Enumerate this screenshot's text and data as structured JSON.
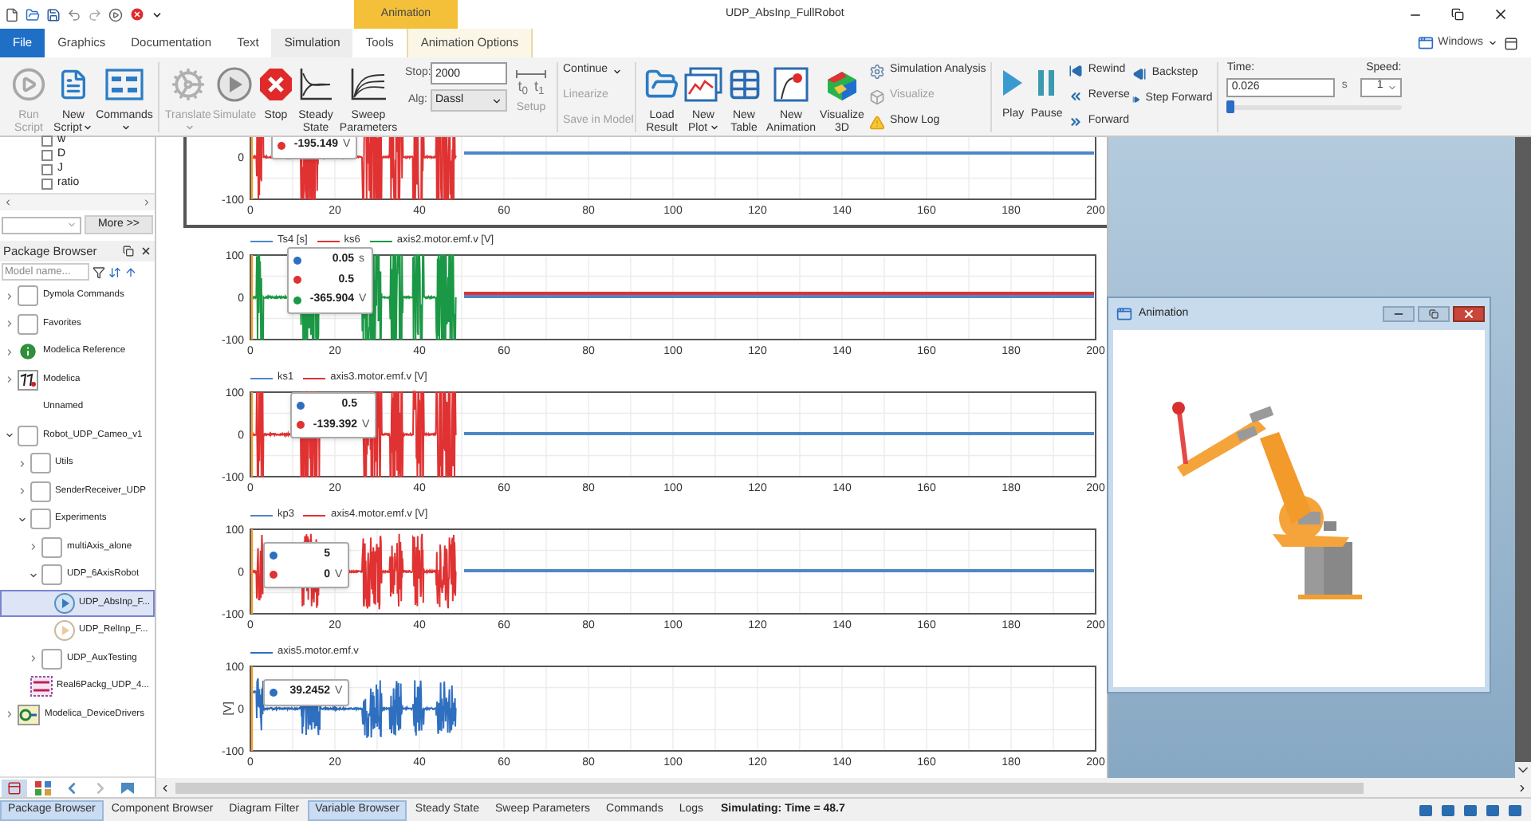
{
  "title_bar": {
    "title": "UDP_AbsInp_FullRobot",
    "context_header": "Animation"
  },
  "menu_tabs": [
    {
      "label": "File",
      "kind": "file",
      "selected": false
    },
    {
      "label": "Graphics",
      "kind": "normal",
      "selected": false
    },
    {
      "label": "Documentation",
      "kind": "normal",
      "selected": false
    },
    {
      "label": "Text",
      "kind": "normal",
      "selected": false
    },
    {
      "label": "Simulation",
      "kind": "normal",
      "selected": true
    },
    {
      "label": "Tools",
      "kind": "normal",
      "selected": false
    },
    {
      "label": "Animation Options",
      "kind": "context",
      "selected": false
    }
  ],
  "windows_menu": {
    "label": "Windows"
  },
  "ribbon": {
    "script": [
      {
        "label": "Run Script",
        "dropdown": false,
        "disabled": true
      },
      {
        "label": "New Script",
        "dropdown": true,
        "disabled": false
      },
      {
        "label": "Commands",
        "dropdown": true,
        "disabled": false
      }
    ],
    "simulate": [
      {
        "label": "Translate",
        "dropdown": true,
        "disabled": true
      },
      {
        "label": "Simulate",
        "dropdown": false,
        "disabled": true
      },
      {
        "label": "Stop",
        "dropdown": false,
        "disabled": false
      },
      {
        "label": "Steady State",
        "dropdown": false,
        "disabled": false
      },
      {
        "label": "Sweep Parameters",
        "dropdown": false,
        "disabled": false
      }
    ],
    "stop_time": {
      "label": "Stop:",
      "value": "2000"
    },
    "algorithm": {
      "label": "Alg:",
      "value": "Dassl"
    },
    "setup": {
      "label": "Setup",
      "icon_labels": [
        "t$_{0}$",
        "t$_{1}$"
      ]
    },
    "continue": [
      {
        "label": "Continue",
        "dropdown": true,
        "disabled": false
      },
      {
        "label": "Linearize",
        "dropdown": false,
        "disabled": true
      },
      {
        "label": "Save in Model",
        "dropdown": false,
        "disabled": true
      }
    ],
    "results": [
      {
        "label": "Load Result",
        "dropdown": false
      },
      {
        "label": "New Plot",
        "dropdown": true
      },
      {
        "label": "New Table",
        "dropdown": false
      },
      {
        "label": "New Animation",
        "dropdown": false
      },
      {
        "label": "Visualize 3D",
        "dropdown": false
      }
    ],
    "analysis": [
      {
        "label": "Simulation Analysis",
        "disabled": false
      },
      {
        "label": "Visualize",
        "disabled": true
      },
      {
        "label": "Show Log",
        "disabled": false
      }
    ],
    "playback": [
      {
        "label": "Play"
      },
      {
        "label": "Pause"
      }
    ],
    "steps": [
      {
        "label": "Rewind"
      },
      {
        "label": "Reverse"
      },
      {
        "label": "Forward"
      },
      {
        "label": "Backstep"
      },
      {
        "label": "Step Forward"
      }
    ],
    "time": {
      "label": "Time:",
      "value": "0.026",
      "unit": "s",
      "level": 0
    },
    "speed": {
      "label": "Speed:",
      "value": "1"
    }
  },
  "variables": [
    {
      "label": "w",
      "checked": false
    },
    {
      "label": "D",
      "checked": false
    },
    {
      "label": "J",
      "checked": false
    },
    {
      "label": "ratio",
      "checked": false
    }
  ],
  "more_button": "More >>",
  "package_browser": {
    "title": "Package Browser",
    "search": {
      "placeholder": "Model name..."
    },
    "tree": [
      {
        "label": "Dymola Commands",
        "kind": "package",
        "expanded": false,
        "selected": false
      },
      {
        "label": "Favorites",
        "kind": "package",
        "expanded": false,
        "selected": false
      },
      {
        "label": "Modelica Reference",
        "kind": "info",
        "expanded": false,
        "selected": false
      },
      {
        "label": "Modelica",
        "kind": "modelica",
        "expanded": false,
        "selected": false
      },
      {
        "label": "Unnamed",
        "kind": "none",
        "selected": false
      },
      {
        "label": "Robot_UDP_Cameo_v1",
        "kind": "package",
        "expanded": true,
        "selected": false,
        "children": [
          {
            "label": "Utils",
            "kind": "package",
            "expanded": false,
            "selected": false
          },
          {
            "label": "SenderReceiver_UDP",
            "kind": "package",
            "expanded": false,
            "selected": false
          },
          {
            "label": "Experiments",
            "kind": "package",
            "expanded": true,
            "selected": false,
            "children": [
              {
                "label": "multiAxis_alone",
                "kind": "package",
                "expanded": false,
                "selected": false
              },
              {
                "label": "UDP_6AxisRobot",
                "kind": "package",
                "expanded": true,
                "selected": false,
                "children": [
                  {
                    "label": "UDP_AbsInp_F...",
                    "kind": "model-run",
                    "selected": true
                  },
                  {
                    "label": "UDP_RelInp_F...",
                    "kind": "model",
                    "selected": false
                  }
                ]
              },
              {
                "label": "UDP_AuxTesting",
                "kind": "package",
                "expanded": false,
                "selected": false
              }
            ]
          },
          {
            "label": "Real6Packg_UDP_4...",
            "kind": "dymola",
            "selected": false
          }
        ]
      },
      {
        "label": "Modelica_DeviceDrivers",
        "kind": "driver",
        "expanded": false,
        "selected": false
      }
    ]
  },
  "plots": [
    {
      "selected": true,
      "series": [
        {
          "kind": "signal",
          "color": "#e03232"
        },
        {
          "kind": "parameter",
          "color": "#4f86c6"
        }
      ],
      "readouts": [
        {
          "value": "-195.149",
          "unit": "V",
          "color": "#e03232"
        }
      ],
      "yticks": [
        "0",
        "-100"
      ],
      "xticks": [
        "0",
        "20",
        "40",
        "60",
        "80",
        "100",
        "120",
        "140",
        "160",
        "180",
        "200"
      ]
    },
    {
      "selected": false,
      "series": [
        {
          "name": "Ts4 [s]",
          "kind": "parameter",
          "color": "#4f86c6"
        },
        {
          "name": "ks6",
          "kind": "parameter",
          "color": "#e03232"
        },
        {
          "name": "axis2.motor.emf.v [V]",
          "kind": "signal",
          "color": "#1b9845"
        }
      ],
      "readouts": [
        {
          "value": "0.05",
          "unit": "s",
          "color": "#2f6fc0"
        },
        {
          "value": "0.5",
          "color": "#e03232"
        },
        {
          "value": "-365.904",
          "unit": "V",
          "color": "#1b9845"
        }
      ],
      "yticks": [
        "100",
        "0",
        "-100"
      ],
      "xticks": [
        "0",
        "20",
        "40",
        "60",
        "80",
        "100",
        "120",
        "140",
        "160",
        "180",
        "200"
      ]
    },
    {
      "selected": false,
      "series": [
        {
          "name": "ks1",
          "kind": "parameter",
          "color": "#4f86c6"
        },
        {
          "name": "axis3.motor.emf.v [V]",
          "kind": "signal",
          "color": "#e03232"
        }
      ],
      "readouts": [
        {
          "value": "0.5",
          "color": "#2f6fc0"
        },
        {
          "value": "-139.392",
          "unit": "V",
          "color": "#e03232"
        }
      ],
      "yticks": [
        "100",
        "0",
        "-100"
      ],
      "xticks": [
        "0",
        "20",
        "40",
        "60",
        "80",
        "100",
        "120",
        "140",
        "160",
        "180",
        "200"
      ]
    },
    {
      "selected": false,
      "series": [
        {
          "name": "kp3",
          "kind": "parameter",
          "color": "#4f86c6"
        },
        {
          "name": "axis4.motor.emf.v [V]",
          "kind": "signal",
          "color": "#e03232"
        }
      ],
      "readouts": [
        {
          "value": "5",
          "color": "#2f6fc0"
        },
        {
          "value": "0",
          "unit": "V",
          "color": "#e03232"
        }
      ],
      "yticks": [
        "100",
        "0",
        "-100"
      ],
      "xticks": [
        "0",
        "20",
        "40",
        "60",
        "80",
        "100",
        "120",
        "140",
        "160",
        "180",
        "200"
      ]
    },
    {
      "selected": false,
      "ylabel": "[V]",
      "series": [
        {
          "name": "axis5.motor.emf.v",
          "kind": "signal",
          "color": "#2f6fc0"
        }
      ],
      "readouts": [
        {
          "value": "39.2452",
          "unit": "V",
          "color": "#2f6fc0"
        }
      ],
      "yticks": [
        "100",
        "0",
        "-100"
      ],
      "xticks": [
        "0",
        "20",
        "40",
        "60",
        "80",
        "100",
        "120",
        "140",
        "160",
        "180",
        "200"
      ]
    }
  ],
  "animation_window": {
    "title": "Animation"
  },
  "bottom_tabs": [
    {
      "label": "Package Browser",
      "selected": true
    },
    {
      "label": "Component Browser",
      "selected": false
    },
    {
      "label": "Diagram Filter",
      "selected": false
    },
    {
      "label": "Variable Browser",
      "selected": true
    },
    {
      "label": "Steady State",
      "selected": false
    },
    {
      "label": "Sweep Parameters",
      "selected": false
    },
    {
      "label": "Commands",
      "selected": false
    },
    {
      "label": "Logs",
      "selected": false
    }
  ],
  "status": "Simulating: Time = 48.7"
}
